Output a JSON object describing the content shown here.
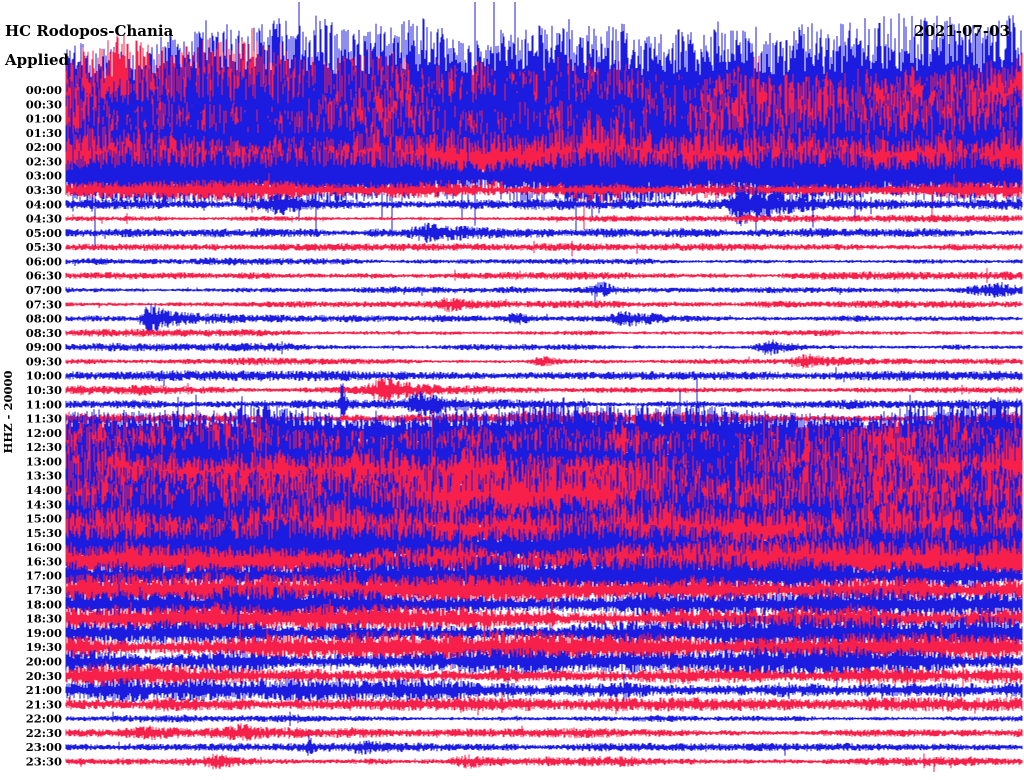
{
  "chart_data": {
    "type": "line",
    "kind": "seismogram-helicorder",
    "title": "HC Rodopos-Chania",
    "subtitle": "Applied",
    "date": "2021-07-03",
    "scale_label": "HHZ - 20000",
    "row_interval": "30 min",
    "legend_position": "none",
    "grid": false,
    "colors": {
      "blue": "#1c1ce0",
      "red": "#f7204b"
    },
    "amp_note": "amp = half-amplitude of trace noise in px; events: x = fraction of trace width, a = extra amplitude px, w = rise width px, d = decay length px",
    "rows": [
      {
        "label": "00:00",
        "color": "blue",
        "amp": 55,
        "events": []
      },
      {
        "label": "00:30",
        "color": "red",
        "amp": 52,
        "events": []
      },
      {
        "label": "01:00",
        "color": "blue",
        "amp": 50,
        "events": []
      },
      {
        "label": "01:30",
        "color": "red",
        "amp": 48,
        "events": []
      },
      {
        "label": "02:00",
        "color": "blue",
        "amp": 46,
        "events": []
      },
      {
        "label": "02:30",
        "color": "red",
        "amp": 36,
        "events": []
      },
      {
        "label": "03:00",
        "color": "blue",
        "amp": 24,
        "events": []
      },
      {
        "label": "03:30",
        "color": "red",
        "amp": 8,
        "events": []
      },
      {
        "label": "04:00",
        "color": "blue",
        "amp": 6,
        "events": [
          {
            "x": 0.705,
            "a": 16,
            "w": 6,
            "d": 40
          },
          {
            "x": 0.229,
            "a": 7,
            "w": 18
          }
        ]
      },
      {
        "label": "04:30",
        "color": "red",
        "amp": 2.8,
        "events": []
      },
      {
        "label": "05:00",
        "color": "blue",
        "amp": 4.5,
        "events": [
          {
            "x": 0.381,
            "a": 6,
            "w": 14
          }
        ]
      },
      {
        "label": "05:30",
        "color": "red",
        "amp": 3,
        "events": []
      },
      {
        "label": "06:00",
        "color": "blue",
        "amp": 3,
        "events": []
      },
      {
        "label": "06:30",
        "color": "red",
        "amp": 3.2,
        "events": []
      },
      {
        "label": "07:00",
        "color": "blue",
        "amp": 3,
        "events": [
          {
            "x": 0.564,
            "a": 6,
            "w": 10
          },
          {
            "x": 0.977,
            "a": 5,
            "w": 20,
            "d": 20
          }
        ]
      },
      {
        "label": "07:30",
        "color": "red",
        "amp": 3,
        "events": [
          {
            "x": 0.402,
            "a": 5,
            "w": 10
          }
        ]
      },
      {
        "label": "08:00",
        "color": "blue",
        "amp": 3.2,
        "events": [
          {
            "x": 0.088,
            "a": 13,
            "w": 5,
            "d": 25
          },
          {
            "x": 0.475,
            "a": 4,
            "w": 10
          },
          {
            "x": 0.59,
            "a": 5,
            "w": 12
          }
        ]
      },
      {
        "label": "08:30",
        "color": "red",
        "amp": 3,
        "events": []
      },
      {
        "label": "09:00",
        "color": "blue",
        "amp": 3.2,
        "events": [
          {
            "x": 0.736,
            "a": 7,
            "w": 8,
            "d": 20
          }
        ]
      },
      {
        "label": "09:30",
        "color": "red",
        "amp": 3,
        "events": [
          {
            "x": 0.501,
            "a": 4,
            "w": 10
          },
          {
            "x": 0.778,
            "a": 4,
            "w": 10
          }
        ]
      },
      {
        "label": "10:00",
        "color": "blue",
        "amp": 4,
        "events": []
      },
      {
        "label": "10:30",
        "color": "red",
        "amp": 4,
        "events": [
          {
            "x": 0.339,
            "a": 10,
            "w": 14,
            "d": 30
          }
        ]
      },
      {
        "label": "11:00",
        "color": "blue",
        "amp": 4,
        "events": [
          {
            "x": 0.37,
            "a": 11,
            "w": 8,
            "d": 30
          },
          {
            "x": 0.289,
            "a": 34,
            "w": 1.2,
            "d": 2
          }
        ]
      },
      {
        "label": "11:30",
        "color": "red",
        "amp": 6,
        "events": []
      },
      {
        "label": "12:00",
        "color": "blue",
        "amp": 26,
        "events": []
      },
      {
        "label": "12:30",
        "color": "red",
        "amp": 30,
        "events": []
      },
      {
        "label": "13:00",
        "color": "blue",
        "amp": 34,
        "events": []
      },
      {
        "label": "13:30",
        "color": "red",
        "amp": 36,
        "events": []
      },
      {
        "label": "14:00",
        "color": "blue",
        "amp": 38,
        "events": []
      },
      {
        "label": "14:30",
        "color": "red",
        "amp": 36,
        "events": []
      },
      {
        "label": "15:00",
        "color": "blue",
        "amp": 31,
        "events": []
      },
      {
        "label": "15:30",
        "color": "red",
        "amp": 27,
        "events": []
      },
      {
        "label": "16:00",
        "color": "blue",
        "amp": 23,
        "events": []
      },
      {
        "label": "16:30",
        "color": "red",
        "amp": 19,
        "events": []
      },
      {
        "label": "17:00",
        "color": "blue",
        "amp": 17,
        "events": []
      },
      {
        "label": "17:30",
        "color": "red",
        "amp": 15,
        "events": []
      },
      {
        "label": "18:00",
        "color": "blue",
        "amp": 14,
        "events": []
      },
      {
        "label": "18:30",
        "color": "red",
        "amp": 13,
        "events": []
      },
      {
        "label": "19:00",
        "color": "blue",
        "amp": 13,
        "events": []
      },
      {
        "label": "19:30",
        "color": "red",
        "amp": 12,
        "events": []
      },
      {
        "label": "20:00",
        "color": "blue",
        "amp": 12,
        "events": []
      },
      {
        "label": "20:30",
        "color": "red",
        "amp": 10,
        "events": []
      },
      {
        "label": "21:00",
        "color": "blue",
        "amp": 9,
        "events": []
      },
      {
        "label": "21:30",
        "color": "red",
        "amp": 5.5,
        "events": [
          {
            "x": 0.42,
            "a": 3,
            "w": 12
          }
        ]
      },
      {
        "label": "22:00",
        "color": "blue",
        "amp": 3,
        "events": []
      },
      {
        "label": "22:30",
        "color": "red",
        "amp": 4,
        "events": [
          {
            "x": 0.088,
            "a": 5,
            "w": 12
          },
          {
            "x": 0.187,
            "a": 5,
            "w": 10
          }
        ]
      },
      {
        "label": "23:00",
        "color": "blue",
        "amp": 3.2,
        "events": [
          {
            "x": 0.255,
            "a": 9,
            "w": 1.5,
            "d": 2
          },
          {
            "x": 0.313,
            "a": 4,
            "w": 10
          }
        ]
      },
      {
        "label": "23:30",
        "color": "red",
        "amp": 4,
        "events": [
          {
            "x": 0.161,
            "a": 5,
            "w": 14
          },
          {
            "x": 0.423,
            "a": 4,
            "w": 12
          }
        ]
      }
    ]
  }
}
